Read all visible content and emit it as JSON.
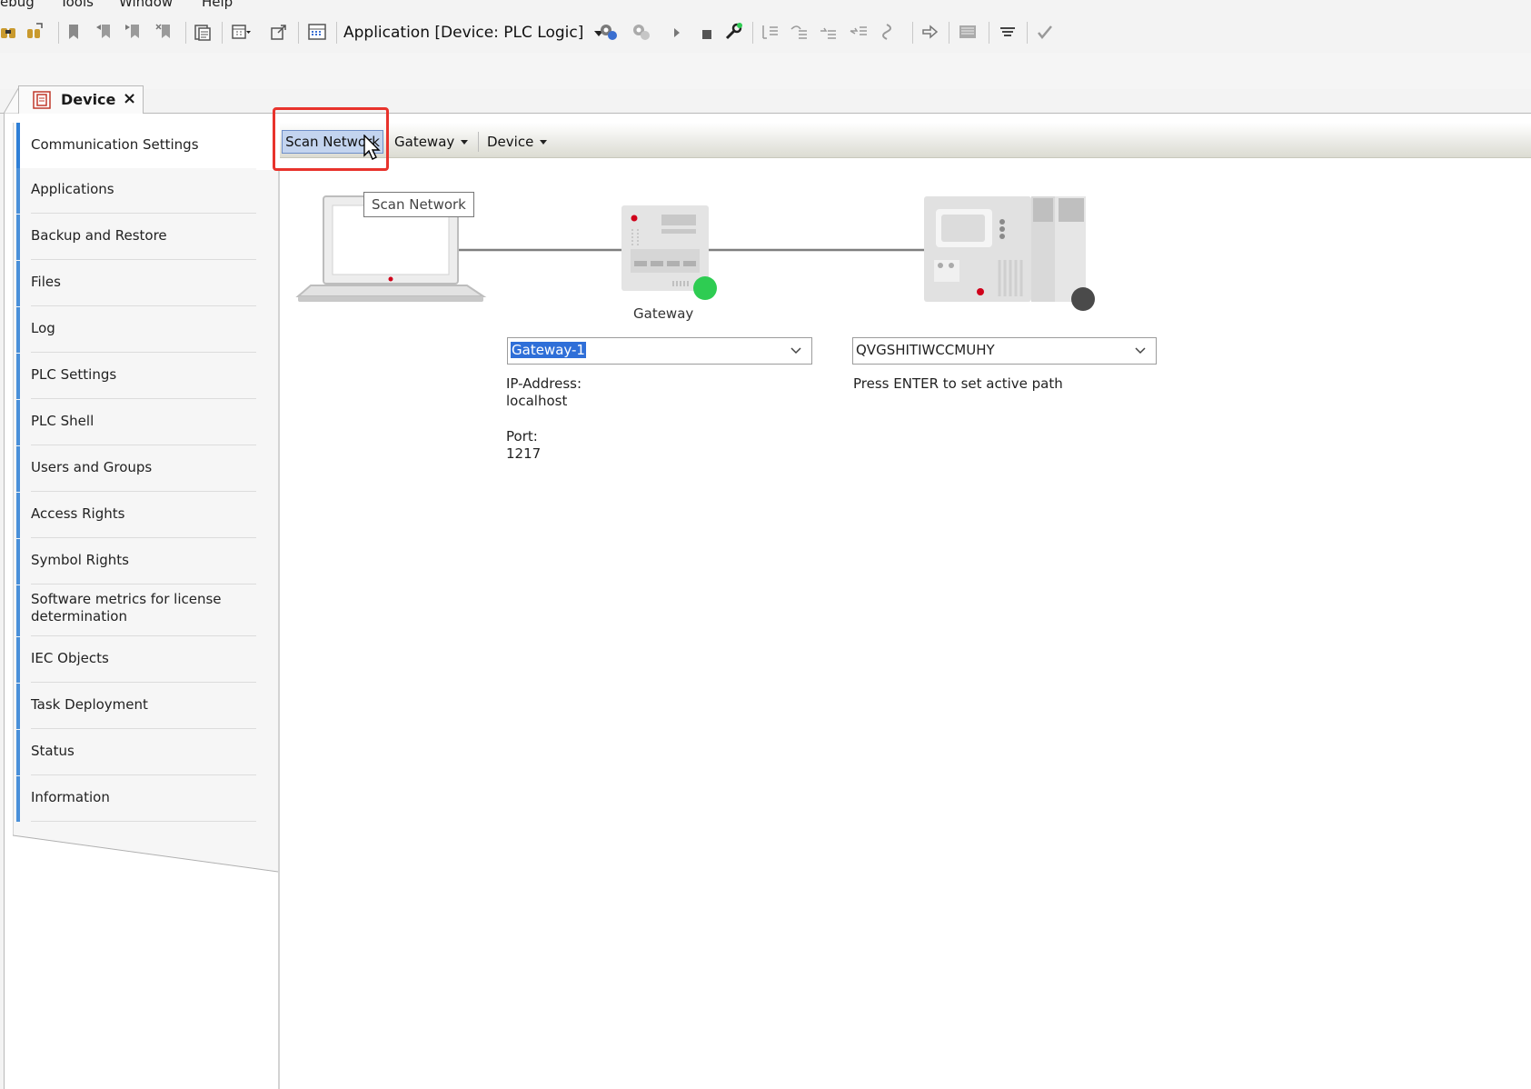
{
  "menubar": {
    "items": [
      "ebug",
      "Tools",
      "Window",
      "Help"
    ]
  },
  "toolbar": {
    "application_select": "Application [Device: PLC Logic]",
    "icons": [
      "binoculars-icon",
      "binoculars-replace-icon",
      "bookmark-icon",
      "bookmark-prev-icon",
      "bookmark-next-icon",
      "bookmark-clear-icon",
      "paste-icon",
      "calendar-dropdown-icon",
      "export-icon",
      "build-icon",
      "login-icon",
      "logout-icon",
      "run-icon",
      "stop-icon",
      "reset-icon",
      "step-into-icon",
      "step-over-icon",
      "step-out-icon",
      "run-to-cursor-icon",
      "show-next-statement-icon",
      "breakpoint-icon",
      "monitor-icon",
      "force-icon",
      "write-icon"
    ]
  },
  "doc_tab": {
    "label": "Device",
    "close": "×"
  },
  "sidebar": {
    "items": [
      {
        "label": "Communication Settings",
        "active": true
      },
      {
        "label": "Applications"
      },
      {
        "label": "Backup and Restore"
      },
      {
        "label": "Files"
      },
      {
        "label": "Log"
      },
      {
        "label": "PLC Settings"
      },
      {
        "label": "PLC Shell"
      },
      {
        "label": "Users and Groups"
      },
      {
        "label": "Access Rights"
      },
      {
        "label": "Symbol Rights"
      },
      {
        "label": "Software metrics for license determination"
      },
      {
        "label": "IEC Objects"
      },
      {
        "label": "Task Deployment"
      },
      {
        "label": "Status"
      },
      {
        "label": "Information"
      }
    ]
  },
  "content_toolbar": {
    "scan_label": "Scan Network",
    "gateway_label": "Gateway",
    "device_label": "Device"
  },
  "tooltip": "Scan Network",
  "diagram": {
    "gateway_label": "Gateway",
    "gateway_status_color": "#2ecc52",
    "device_status_color": "#4a4a4a"
  },
  "gateway": {
    "selected": "Gateway-1",
    "ip_label": "IP-Address:",
    "ip_value": "localhost",
    "port_label": "Port:",
    "port_value": "1217"
  },
  "device": {
    "selected": "QVGSHITIWCCMUHY",
    "hint": "Press ENTER to set active path"
  },
  "colors": {
    "highlight": "#e8332c",
    "accent": "#2f7fd6",
    "selection": "#2f6fd8"
  }
}
